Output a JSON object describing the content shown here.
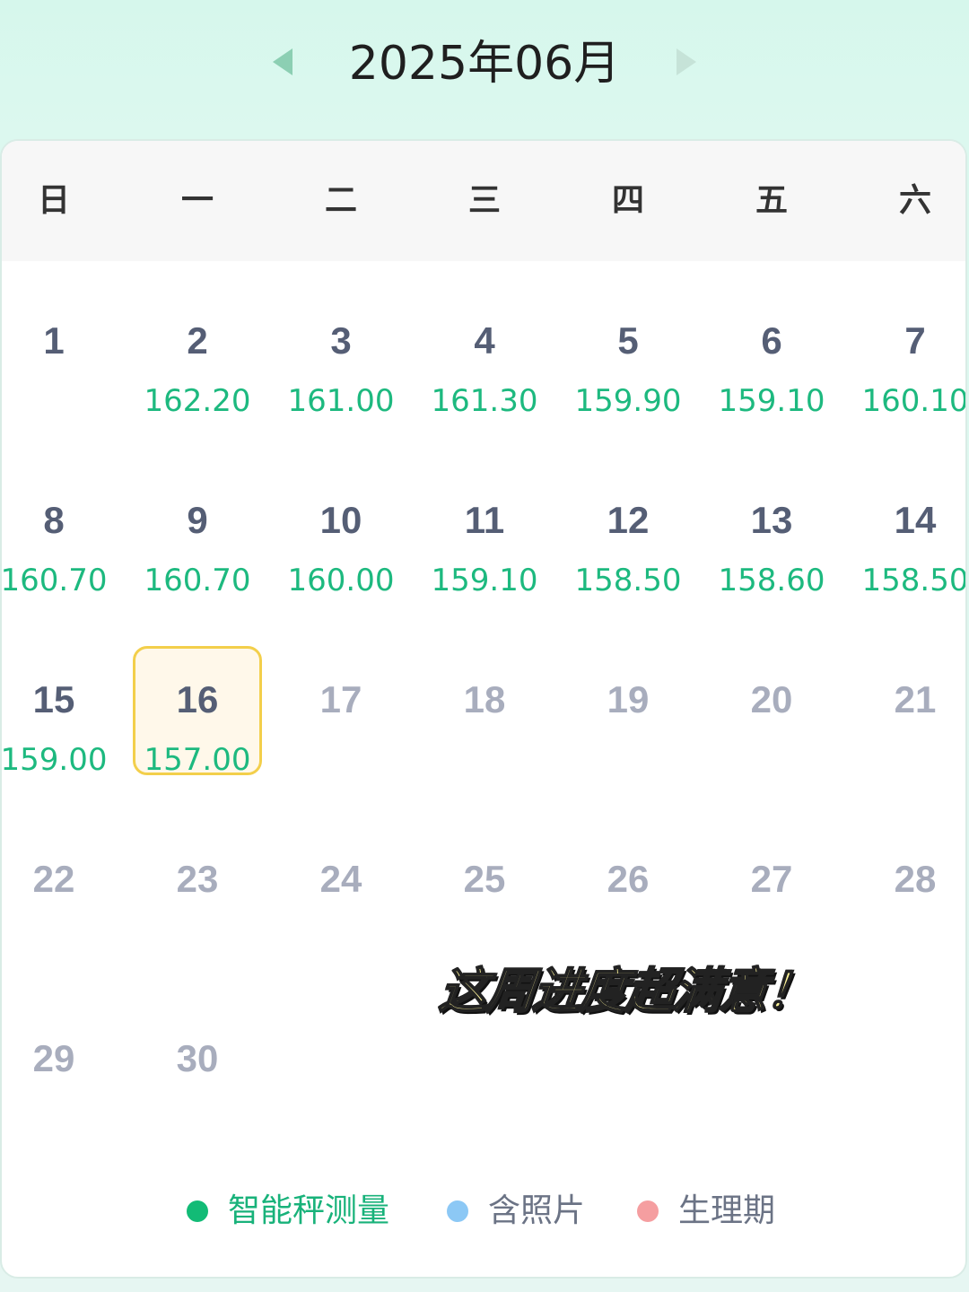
{
  "header": {
    "title": "2025年06月",
    "prev_icon": "chevron-left-icon",
    "next_icon": "chevron-right-icon"
  },
  "weekdays": [
    "日",
    "一",
    "二",
    "三",
    "四",
    "五",
    "六"
  ],
  "days": [
    {
      "num": "1",
      "value": ""
    },
    {
      "num": "2",
      "value": "162.20"
    },
    {
      "num": "3",
      "value": "161.00"
    },
    {
      "num": "4",
      "value": "161.30"
    },
    {
      "num": "5",
      "value": "159.90"
    },
    {
      "num": "6",
      "value": "159.10"
    },
    {
      "num": "7",
      "value": "160.10"
    },
    {
      "num": "8",
      "value": "160.70"
    },
    {
      "num": "9",
      "value": "160.70"
    },
    {
      "num": "10",
      "value": "160.00"
    },
    {
      "num": "11",
      "value": "159.10"
    },
    {
      "num": "12",
      "value": "158.50"
    },
    {
      "num": "13",
      "value": "158.60"
    },
    {
      "num": "14",
      "value": "158.50"
    },
    {
      "num": "15",
      "value": "159.00"
    },
    {
      "num": "16",
      "value": "157.00",
      "selected": true
    },
    {
      "num": "17",
      "value": "",
      "future": true
    },
    {
      "num": "18",
      "value": "",
      "future": true
    },
    {
      "num": "19",
      "value": "",
      "future": true
    },
    {
      "num": "20",
      "value": "",
      "future": true
    },
    {
      "num": "21",
      "value": "",
      "future": true
    },
    {
      "num": "22",
      "value": "",
      "future": true
    },
    {
      "num": "23",
      "value": "",
      "future": true
    },
    {
      "num": "24",
      "value": "",
      "future": true
    },
    {
      "num": "25",
      "value": "",
      "future": true
    },
    {
      "num": "26",
      "value": "",
      "future": true
    },
    {
      "num": "27",
      "value": "",
      "future": true
    },
    {
      "num": "28",
      "value": "",
      "future": true
    },
    {
      "num": "29",
      "value": "",
      "future": true
    },
    {
      "num": "30",
      "value": "",
      "future": true
    }
  ],
  "overlay_text": "这周进度超满意！",
  "legend": [
    {
      "label": "智能秤测量",
      "color": "#12bb76",
      "text_color": "#18b27a"
    },
    {
      "label": "含照片",
      "color": "#8cc8f5",
      "text_color": "#6b7385"
    },
    {
      "label": "生理期",
      "color": "#f59ea0",
      "text_color": "#6b7385"
    }
  ],
  "colors": {
    "accent": "#1db97f",
    "selected_border": "#f3cf4b",
    "selected_fill": "#fff8ea"
  }
}
